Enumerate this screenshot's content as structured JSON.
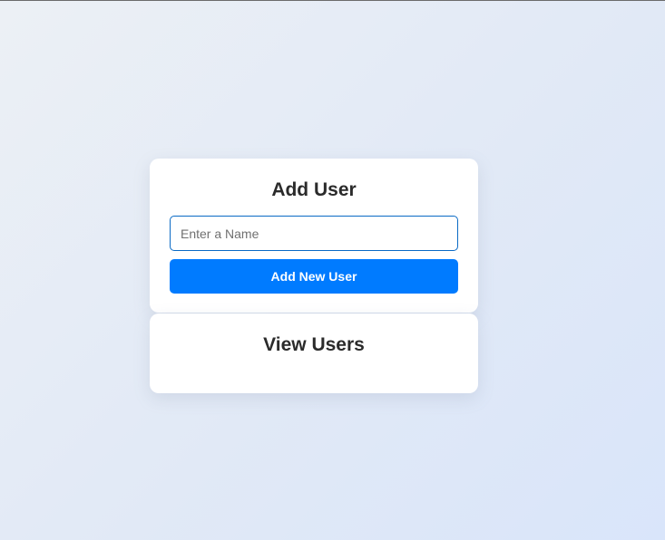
{
  "add_user": {
    "title": "Add User",
    "name_input": {
      "value": "",
      "placeholder": "Enter a Name"
    },
    "submit_label": "Add New User"
  },
  "view_users": {
    "title": "View Users"
  },
  "colors": {
    "accent": "#007bff",
    "input_border": "#0a6ac5",
    "heading": "#2b2b2b"
  }
}
